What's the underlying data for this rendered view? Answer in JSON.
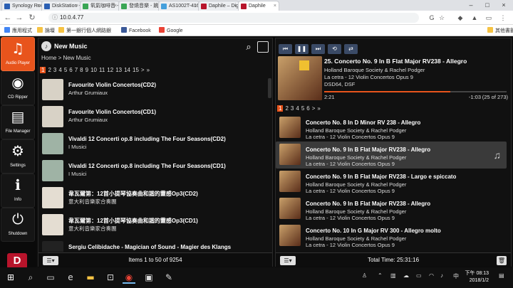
{
  "browser": {
    "tabs": [
      {
        "label": "Synology Rou",
        "color": "#2b5fb3"
      },
      {
        "label": "DiskStation -",
        "color": "#2b5fb3"
      },
      {
        "label": "氧氣咖啡音 -",
        "color": "#3aa655"
      },
      {
        "label": "發燒音樂 - 跳",
        "color": "#3aa655"
      },
      {
        "label": "AS1002T-416",
        "color": "#45a0dc"
      },
      {
        "label": "Daphile – Digi",
        "color": "#b8142b"
      },
      {
        "label": "Daphile",
        "color": "#b8142b"
      }
    ],
    "url": "10.0.4.77",
    "bookmarks": [
      {
        "label": "應用程式",
        "color": "#4285f4"
      },
      {
        "label": "論壇",
        "color": "#f6c344"
      },
      {
        "label": "第一銀行個人網路銀",
        "color": "#f6c344"
      },
      {
        "label": "Facebook",
        "color": "#3b5998"
      },
      {
        "label": "Google",
        "color": "#ea4335"
      },
      {
        "label": "其他書籤",
        "color": "#f6c344"
      }
    ]
  },
  "sidebar": {
    "items": [
      {
        "label": "Audio Player",
        "icon": "♫"
      },
      {
        "label": "CD Ripper",
        "icon": "◉"
      },
      {
        "label": "File Manager",
        "icon": "▤"
      },
      {
        "label": "Settings",
        "icon": "⚙"
      },
      {
        "label": "Info",
        "icon": "ℹ"
      },
      {
        "label": "Shutdown",
        "icon": "⏻"
      }
    ],
    "logo": "D"
  },
  "library": {
    "title": "New Music",
    "breadcrumb": "Home > New Music",
    "pages": [
      "1",
      "2",
      "3",
      "4",
      "5",
      "6",
      "7",
      "8",
      "9",
      "10",
      "11",
      "12",
      "13",
      "14",
      "15",
      ">",
      "»"
    ],
    "items": [
      {
        "title": "Favourite Violin Concertos(CD2)",
        "artist": "Arthur Grumiaux",
        "thumb": "#d8d2c6"
      },
      {
        "title": "Favourite Violin Concertos(CD1)",
        "artist": "Arthur Grumiaux",
        "thumb": "#d8d2c6"
      },
      {
        "title": "Vivaldi 12 Concerti op.8 including The Four Seasons(CD2)",
        "artist": "I Musici",
        "thumb": "#9fb3a5"
      },
      {
        "title": "Vivaldi 12 Concerti op.8 including The Four Seasons(CD1)",
        "artist": "I Musici",
        "thumb": "#9fb3a5"
      },
      {
        "title": "韋瓦爾第：12首小提琴協奏曲和諧的靈感Op3(CD2)",
        "artist": "意大利音樂家合奏團",
        "thumb": "#e4ddd2"
      },
      {
        "title": "韋瓦爾第：12首小提琴協奏曲和諧的靈感Op3(CD1)",
        "artist": "意大利音樂家合奏團",
        "thumb": "#e4ddd2"
      },
      {
        "title": "Sergiu Celibidache - Magician of Sound - Magier des Klangs",
        "artist": "",
        "thumb": "#222"
      }
    ],
    "footer": "Items 1 to 50 of 9254"
  },
  "player": {
    "track_title": "25. Concerto No. 9 In B Flat Major RV238 - Allegro",
    "artist": "Holland Baroque Society & Rachel Podger",
    "album": "La cetra - 12 Violin Concertos Opus 9",
    "format": "DSD64, DSF",
    "elapsed": "2:21",
    "remaining": "-1:03",
    "position": "(25 of 273)",
    "progress": 0.69,
    "pages": [
      "1",
      "2",
      "3",
      "4",
      "5",
      "6",
      ">",
      "»"
    ],
    "queue": [
      {
        "title": "Concerto No. 8 In D Minor RV 238 - Allegro",
        "artist": "Holland Baroque Society & Rachel Podger",
        "album": "La cetra - 12 Violin Concertos Opus 9",
        "current": false
      },
      {
        "title": "Concerto No. 9 In B Flat Major RV238 - Allegro",
        "artist": "Holland Baroque Society & Rachel Podger",
        "album": "La cetra - 12 Violin Concertos Opus 9",
        "current": true
      },
      {
        "title": "Concerto No. 9 In B Flat Major RV238 - Largo e spiccato",
        "artist": "Holland Baroque Society & Rachel Podger",
        "album": "La cetra - 12 Violin Concertos Opus 9",
        "current": false
      },
      {
        "title": "Concerto No. 9 In B Flat Major RV238 - Allegro",
        "artist": "Holland Baroque Society & Rachel Podger",
        "album": "La cetra - 12 Violin Concertos Opus 9",
        "current": false
      },
      {
        "title": "Concerto No. 10 In G Major RV 300 - Allegro molto",
        "artist": "Holland Baroque Society & Rachel Podger",
        "album": "La cetra - 12 Violin Concertos Opus 9",
        "current": false
      }
    ],
    "total_time": "Total Time: 25:31:16"
  },
  "taskbar": {
    "time": "下午 08:13",
    "date": "2018/1/2"
  }
}
